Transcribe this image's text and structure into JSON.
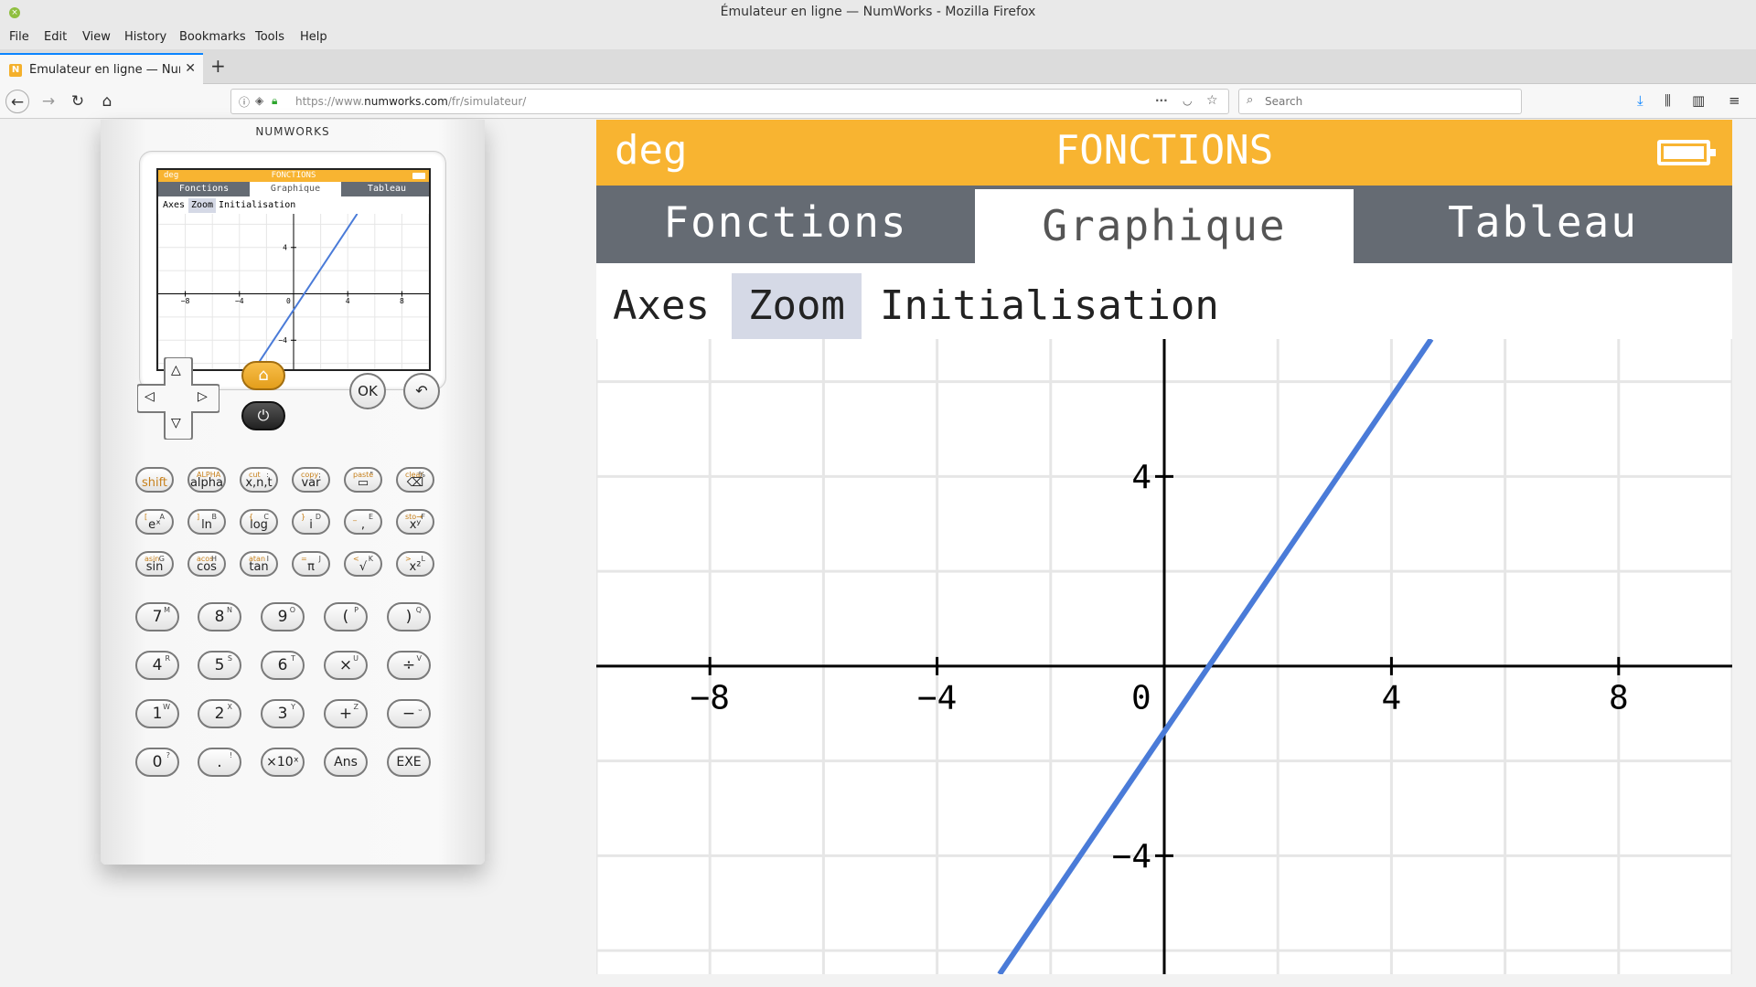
{
  "window": {
    "title": "Émulateur en ligne — NumWorks - Mozilla Firefox"
  },
  "menu": [
    "File",
    "Edit",
    "View",
    "History",
    "Bookmarks",
    "Tools",
    "Help"
  ],
  "tab": {
    "title": "Émulateur en ligne — NumWorks",
    "favicon": "N"
  },
  "url": {
    "prefix": "https://www.",
    "domain": "numworks.com",
    "path": "/fr/simulateur/"
  },
  "search": {
    "placeholder": "Search"
  },
  "calculator": {
    "brand": "NUMWORKS",
    "keys": {
      "ok": "OK",
      "row1": [
        {
          "main": "shift",
          "alt1": "",
          "alt2": ""
        },
        {
          "main": "alpha",
          "alt1": "ALPHA",
          "alt2": ""
        },
        {
          "main": "x,n,t",
          "alt1": "cut",
          "alt2": ":"
        },
        {
          "main": "var",
          "alt1": "copy",
          "alt2": ";"
        },
        {
          "main": "▭",
          "alt1": "paste",
          "alt2": "\""
        },
        {
          "main": "⌫",
          "alt1": "clear",
          "alt2": "%"
        }
      ],
      "row2": [
        {
          "main": "eˣ",
          "alt1": "[",
          "alt2": "A"
        },
        {
          "main": "ln",
          "alt1": "]",
          "alt2": "B"
        },
        {
          "main": "log",
          "alt1": "{",
          "alt2": "C"
        },
        {
          "main": "i",
          "alt1": "}",
          "alt2": "D"
        },
        {
          "main": ",",
          "alt1": "_",
          "alt2": "E"
        },
        {
          "main": "xʸ",
          "alt1": "sto→",
          "alt2": "F"
        }
      ],
      "row3": [
        {
          "main": "sin",
          "alt1": "asin",
          "alt2": "G"
        },
        {
          "main": "cos",
          "alt1": "acos",
          "alt2": "H"
        },
        {
          "main": "tan",
          "alt1": "atan",
          "alt2": "I"
        },
        {
          "main": "π",
          "alt1": "=",
          "alt2": "J"
        },
        {
          "main": "√",
          "alt1": "<",
          "alt2": "K"
        },
        {
          "main": "x²",
          "alt1": ">",
          "alt2": "L"
        }
      ],
      "num": [
        [
          {
            "main": "7",
            "alt2": "M"
          },
          {
            "main": "8",
            "alt2": "N"
          },
          {
            "main": "9",
            "alt2": "O"
          },
          {
            "main": "(",
            "alt2": "P"
          },
          {
            "main": ")",
            "alt2": "Q"
          }
        ],
        [
          {
            "main": "4",
            "alt2": "R"
          },
          {
            "main": "5",
            "alt2": "S"
          },
          {
            "main": "6",
            "alt2": "T"
          },
          {
            "main": "×",
            "alt2": "U"
          },
          {
            "main": "÷",
            "alt2": "V"
          }
        ],
        [
          {
            "main": "1",
            "alt2": "W"
          },
          {
            "main": "2",
            "alt2": "X"
          },
          {
            "main": "3",
            "alt2": "Y"
          },
          {
            "main": "+",
            "alt2": "Z"
          },
          {
            "main": "−",
            "alt2": "⎵"
          }
        ],
        [
          {
            "main": "0",
            "alt2": "?"
          },
          {
            "main": ".",
            "alt2": "!"
          },
          {
            "main": "×10ˣ",
            "alt2": ""
          },
          {
            "main": "Ans",
            "alt2": ""
          },
          {
            "main": "EXE",
            "alt2": ""
          }
        ]
      ]
    }
  },
  "screen": {
    "angle_unit": "deg",
    "app_title": "FONCTIONS",
    "tabs": [
      "Fonctions",
      "Graphique",
      "Tableau"
    ],
    "selected_tab": "Graphique",
    "subtabs": [
      "Axes",
      "Zoom",
      "Initialisation"
    ],
    "selected_subtab": "Zoom",
    "colors": {
      "header": "#f8b431",
      "tabs": "#656b73",
      "curve": "#4a7bd8",
      "selection": "#d5d9e6"
    }
  },
  "chart_data": {
    "type": "line",
    "title": "",
    "xlabel": "",
    "ylabel": "",
    "xlim": [
      -10,
      10
    ],
    "ylim": [
      -6.5,
      6.9
    ],
    "xticks": [
      -8,
      -4,
      0,
      4,
      8
    ],
    "yticks": [
      4,
      -4
    ],
    "grid": true,
    "series": [
      {
        "name": "",
        "x": [
          -2.9,
          4.7
        ],
        "y": [
          -6.5,
          6.9
        ],
        "color": "#4a7bd8"
      }
    ]
  }
}
